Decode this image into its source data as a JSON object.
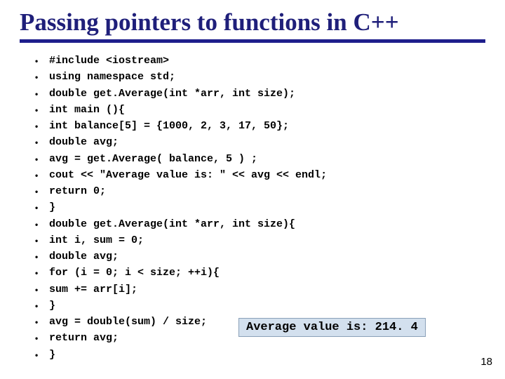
{
  "title": "Passing pointers to functions in C++",
  "bullet_char": "•",
  "code": {
    "l0": "#include <iostream>",
    "l1": "using namespace std;",
    "l2": "double get.Average(int *arr, int size);",
    "l3": "int main (){",
    "l4": "int balance[5] = {1000, 2, 3, 17, 50};",
    "l5": "double avg;",
    "l6": "avg = get.Average( balance, 5 ) ;",
    "l7": "cout << \"Average value is: \" << avg << endl;",
    "l8": "return 0;",
    "l9": "}",
    "l10": "double get.Average(int *arr, int size){",
    "l11": "int i, sum = 0;",
    "l12": "double avg;",
    "l13": "for (i = 0; i < size; ++i){",
    "l14": "sum += arr[i];",
    "l15": "}",
    "l16": "avg = double(sum) / size;",
    "l17": "return avg;",
    "l18": "}"
  },
  "output_text": "Average value is: 214. 4",
  "page_number": "18"
}
